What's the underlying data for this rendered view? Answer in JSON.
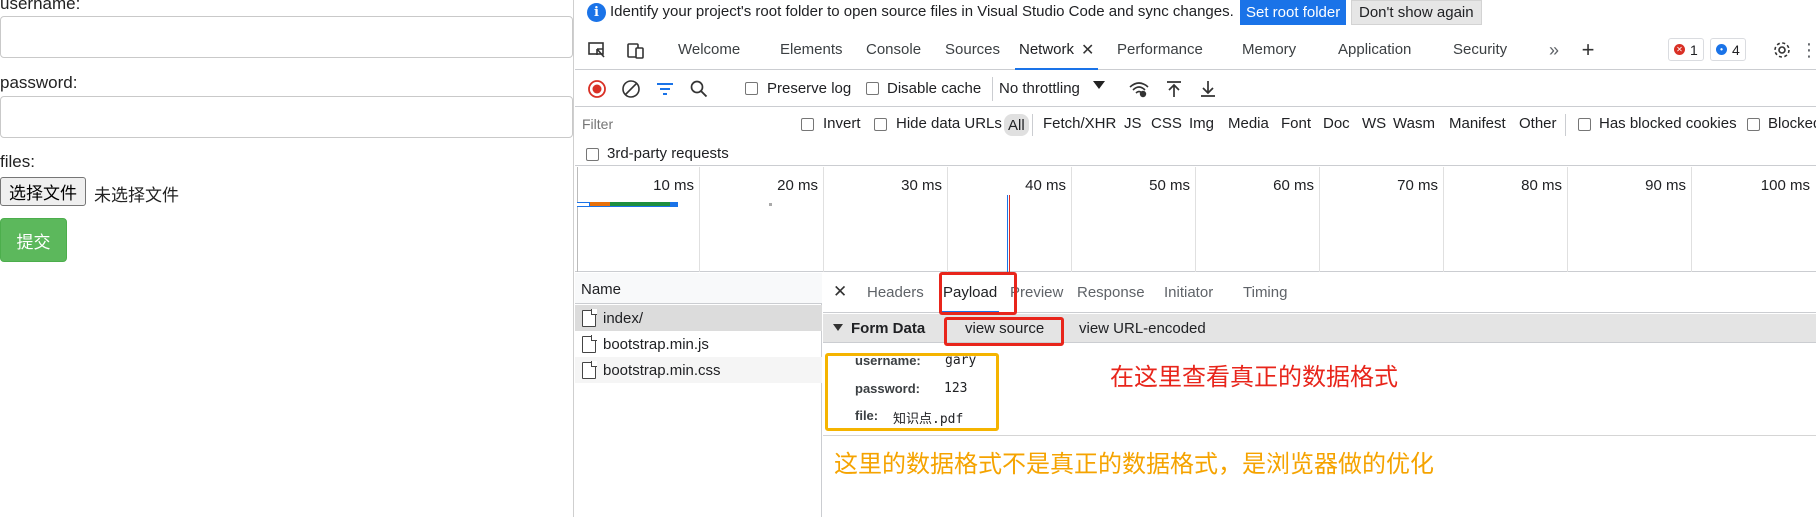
{
  "form": {
    "username_label": "username:",
    "password_label": "password:",
    "files_label": "files:",
    "file_button": "选择文件",
    "file_status": "未选择文件",
    "submit": "提交",
    "colors": {
      "submit_bg": "#5cb85c"
    }
  },
  "devtools": {
    "infobar": {
      "message": "Identify your project's root folder to open source files in Visual Studio Code and sync changes.",
      "set_root": "Set root folder",
      "dont_show": "Don't show again"
    },
    "tabs": [
      "Welcome",
      "Elements",
      "Console",
      "Sources",
      "Network",
      "Performance",
      "Memory",
      "Application",
      "Security"
    ],
    "active_tab": "Network",
    "badges": {
      "errors": "1",
      "messages": "4"
    },
    "icons": {
      "inspect": "inspect-icon",
      "device": "device-toolbar-icon",
      "more_tabs": "chevron-double-right-icon",
      "add_tab": "plus-icon",
      "settings": "gear-icon",
      "record": "record-stop-icon",
      "clear": "clear-icon",
      "filter": "filter-icon",
      "search": "search-icon",
      "network_conditions": "wifi-settings-icon",
      "import": "upload-icon",
      "export": "download-icon"
    },
    "toolbar": {
      "preserve_log": "Preserve log",
      "disable_cache": "Disable cache",
      "throttling": "No throttling"
    },
    "filter": {
      "placeholder": "Filter",
      "invert": "Invert",
      "hide_data_urls": "Hide data URLs",
      "types": [
        "All",
        "Fetch/XHR",
        "JS",
        "CSS",
        "Img",
        "Media",
        "Font",
        "Doc",
        "WS",
        "Wasm",
        "Manifest",
        "Other"
      ],
      "has_blocked_cookies": "Has blocked cookies",
      "blocked": "Blocked",
      "third_party": "3rd-party requests"
    },
    "timeline": {
      "ticks": [
        "10 ms",
        "20 ms",
        "30 ms",
        "40 ms",
        "50 ms",
        "60 ms",
        "70 ms",
        "80 ms",
        "90 ms",
        "100 ms"
      ]
    },
    "requests": {
      "name_header": "Name",
      "rows": [
        "index/",
        "bootstrap.min.js",
        "bootstrap.min.css"
      ]
    },
    "detail": {
      "tabs": [
        "Headers",
        "Payload",
        "Preview",
        "Response",
        "Initiator",
        "Timing"
      ],
      "active_tab": "Payload",
      "form_data_title": "Form Data",
      "view_source": "view source",
      "view_url_encoded": "view URL-encoded",
      "fields": [
        {
          "key": "username:",
          "value": "gary"
        },
        {
          "key": "password:",
          "value": "123"
        },
        {
          "key": "file:",
          "value": "知识点.pdf"
        }
      ]
    }
  },
  "annotations": {
    "red_note": "在这里查看真正的数据格式",
    "yellow_note": "这里的数据格式不是真正的数据格式，是浏览器做的优化",
    "colors": {
      "red": "#e8251b",
      "yellow": "#f5b400"
    }
  }
}
